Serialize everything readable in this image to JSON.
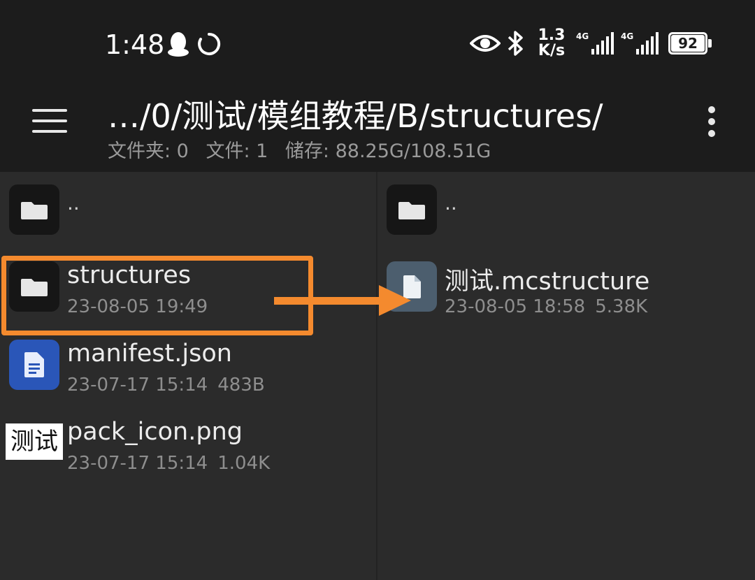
{
  "status_bar": {
    "time": "1:48",
    "net_speed_value": "1.3",
    "net_speed_unit": "K/s",
    "signal_1_label": "4G",
    "signal_2_label": "4G",
    "battery": "92",
    "icons": [
      "qq-penguin-icon",
      "sync-icon",
      "eye-icon",
      "bluetooth-icon",
      "signal-icon",
      "signal-icon",
      "battery-icon"
    ]
  },
  "appbar": {
    "path": "…/0/测试/模组教程/B/structures/",
    "folders_label": "文件夹: 0",
    "files_label": "文件: 1",
    "storage_label": "储存: 88.25G/108.51G",
    "menu_icon": "hamburger-menu-icon",
    "overflow_icon": "more-vert-icon"
  },
  "left_pane": {
    "parent": {
      "name": "..",
      "icon": "folder-icon"
    },
    "items": [
      {
        "name": "structures",
        "date": "23-08-05 19:49",
        "size": "",
        "icon": "folder-icon"
      },
      {
        "name": "manifest.json",
        "date": "23-07-17 15:14",
        "size": "483B",
        "icon": "document-icon"
      },
      {
        "name": "pack_icon.png",
        "date": "23-07-17 15:14",
        "size": "1.04K",
        "thumb_text": "测试"
      }
    ]
  },
  "right_pane": {
    "parent": {
      "name": "..",
      "icon": "folder-icon"
    },
    "items": [
      {
        "name": "测试.mcstructure",
        "date": "23-08-05 18:58",
        "size": "5.38K",
        "icon": "file-icon"
      }
    ]
  },
  "annotation": {
    "color": "#f48a2e"
  },
  "colors": {
    "background": "#1c1c1c",
    "pane": "#2b2b2b",
    "accent": "#f48a2e",
    "json_icon": "#2a56b8",
    "file_icon": "#4c5e6e"
  }
}
